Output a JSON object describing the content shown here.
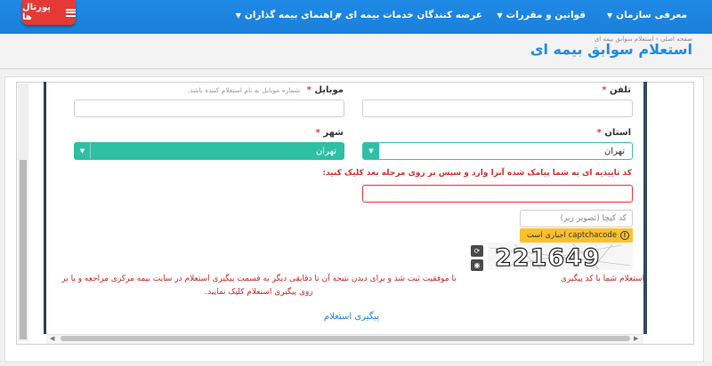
{
  "nav": {
    "items": [
      {
        "label": "معرفی سازمان"
      },
      {
        "label": "قوانین و مقررات"
      },
      {
        "label": "عرضه کنندگان خدمات بیمه ای"
      },
      {
        "label": "راهنمای بیمه گذاران"
      }
    ],
    "portals_label": "پورتال ها"
  },
  "header": {
    "breadcrumb": "صفحه اصلی › استعلام سوابق بیمه ای",
    "title": "استعلام سوابق بیمه ای"
  },
  "form": {
    "phone": {
      "label": "تلفن",
      "required": "*",
      "value": ""
    },
    "mobile": {
      "label": "موبایل",
      "required": "*",
      "hint": "شماره موبایل به نام استعلام کننده باشد.",
      "value": ""
    },
    "province": {
      "label": "استان",
      "required": "*",
      "value": "تهران"
    },
    "city": {
      "label": "شهر",
      "required": "*",
      "value": "تهران"
    },
    "confirm_code": {
      "label": "کد تاییدیه ای به شما پیامک شده آنرا وارد و سپس بر روی مرحله بعد کلیک کنید:",
      "value": ""
    },
    "captcha": {
      "placeholder": "کد کپچا (تصویر زیر)",
      "warning": "captchacode اجباری است",
      "image_text": "221649"
    },
    "result": {
      "label": "استعلام شما با کد پیگیری",
      "message": "با موفقیت ثبت شد و برای دیدن نتیجه آن تا دقایقی دیگر به قسمت پیگیری استعلام در سایت بیمه مرکزی مراجعه و یا بر روی پیگیری استعلام کلیک نمایید."
    },
    "followup_link": "پیگیری استعلام"
  },
  "colors": {
    "brand": "#1f8ae6",
    "teal": "#2ebfa5",
    "error": "#d32f2f",
    "warning": "#fbc02d",
    "portal": "#e53935"
  }
}
